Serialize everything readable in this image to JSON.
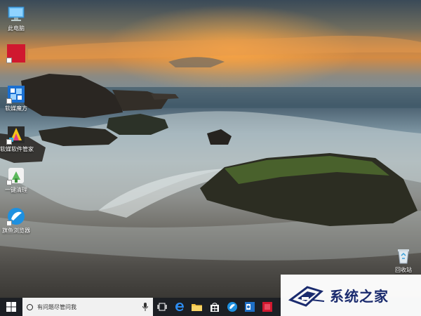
{
  "desktop": {
    "icons": [
      {
        "label": "此电脑",
        "icon": "computer-icon"
      },
      {
        "label": "",
        "icon": "red-app-icon"
      },
      {
        "label": "软媒魔方",
        "icon": "ruanmei-mofang-icon"
      },
      {
        "label": "软媒软件管家",
        "icon": "ruanmei-software-manager-icon"
      },
      {
        "label": "一键清理",
        "icon": "one-click-clean-icon"
      },
      {
        "label": "旗鱼浏览器",
        "icon": "qiyu-browser-icon"
      },
      {
        "label": "回收站",
        "icon": "recycle-bin-icon"
      }
    ]
  },
  "taskbar": {
    "search_placeholder": "有问题尽管问我",
    "apps": [
      "task-view-icon",
      "edge-icon",
      "file-explorer-icon",
      "store-icon",
      "app-blue-icon",
      "app-outlook-icon",
      "app-red-icon"
    ]
  },
  "watermark": {
    "text": "系统之家"
  }
}
